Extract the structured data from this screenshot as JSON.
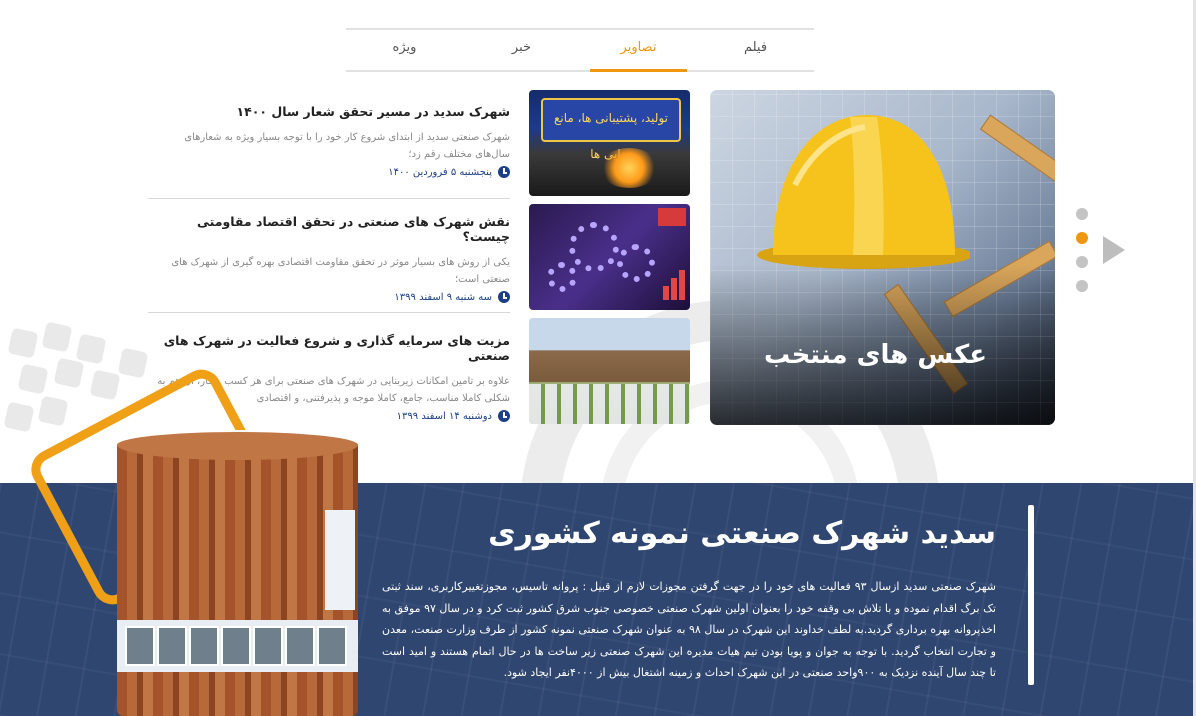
{
  "tabs": [
    {
      "label": "فیلم",
      "active": false
    },
    {
      "label": "تصاویر",
      "active": true
    },
    {
      "label": "خبر",
      "active": false
    },
    {
      "label": "ویژه",
      "active": false
    }
  ],
  "featured": {
    "title": "عکس های منتخب"
  },
  "thumbnails": [
    {
      "icon": "factory-welding-image",
      "banner_text": "تولید، پشتیبانی ها، مانع زدایی ها"
    },
    {
      "icon": "gears-economy-image"
    },
    {
      "icon": "industrial-park-buildings-image"
    }
  ],
  "news": [
    {
      "title": "شهرک سدید در مسیر تحقق شعار سال ۱۴۰۰",
      "text": "شهرک صنعتی سدید از ابتدای شروع کار خود را با توجه بسیار ویژه به شعارهای سال‌های مختلف رقم زد؛",
      "date": "پنجشنبه ۵ فروردین ۱۴۰۰"
    },
    {
      "title": "نقش شهرک های صنعتی در تحقق اقتصاد مقاومتی چیست؟",
      "text": "یکی از روش های بسیار موثر در تحقق مقاومت اقتصادی بهره گیری از شهرک های صنعتی است؛",
      "date": "سه شنبه ۹ اسفند ۱۳۹۹"
    },
    {
      "title": "مزیت های سرمایه گذاری و شروع فعالیت در شهرک های صنعتی",
      "text": "علاوه بر تامین امکانات زیربنایی در شهرک های صنعتی برای هر کسب و کار، آن هم به شکلی کاملا مناسب، جامع، کاملا موجه و پذیرفتنی، و اقتصادی",
      "date": "دوشنبه ۱۴ اسفند ۱۳۹۹"
    }
  ],
  "slider": {
    "dots": 4,
    "active_dot": 2
  },
  "about": {
    "title": "سدید شهرک صنعتی نمونه کشوری",
    "text": "شهرک صنعتی سدید ازسال ۹۳ فعالیت های خود را در جهت گرفتن مجوزات لازم از قبیل : پروانه تاسیس، مجوزتغییرکاربری، سند ثبتی تک برگ اقدام نموده و با تلاش بی وقفه خود را بعنوان اولین شهرک صنعتی خصوصی جنوب شرق کشور ثبت کرد و در سال ۹۷ موفق به اخذپروانه بهره برداری گردید.به لطف خداوند این شهرک در سال ۹۸ به عنوان شهرک صنعتی نمونه کشور از طرف وزارت صنعت، معدن و تجارت انتخاب گردید. با توجه به جوان و پویا بودن تیم هیات مدیره این شهرک صنعتی زیر ساخت ها در حال اتمام هستند و امید است تا چند سال آینده نزدیک به ۹۰۰واحد صنعتی در این شهرک احداث و زمینه اشتغال بیش از ۴۰۰۰نفر ایجاد شود."
  },
  "colors": {
    "accent": "#f0960f",
    "band": "#2f4670",
    "date_text": "#1c3f8c"
  }
}
